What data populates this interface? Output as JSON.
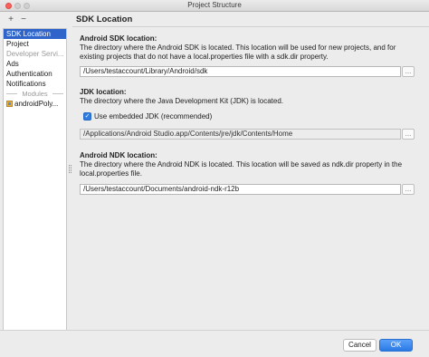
{
  "window": {
    "title": "Project Structure"
  },
  "sidebar": {
    "add_icon": "+",
    "remove_icon": "−",
    "items": [
      {
        "label": "SDK Location",
        "selected": true
      },
      {
        "label": "Project",
        "selected": false
      }
    ],
    "group_label": "Developer Servi...",
    "group_items": [
      "Ads",
      "Authentication",
      "Notifications"
    ],
    "modules_label": "Modules",
    "modules": [
      "androidPoly..."
    ]
  },
  "content": {
    "heading": "SDK Location",
    "android_sdk": {
      "title": "Android SDK location:",
      "description": "The directory where the Android SDK is located. This location will be used for new projects, and for existing projects that do not have a local.properties file with a sdk.dir property.",
      "value": "/Users/testaccount/Library/Android/sdk",
      "browse_label": "..."
    },
    "jdk": {
      "title": "JDK location:",
      "description": "The directory where the Java Development Kit (JDK) is located.",
      "checkbox_label": "Use embedded JDK (recommended)",
      "checkbox_checked": true,
      "value": "/Applications/Android Studio.app/Contents/jre/jdk/Contents/Home",
      "browse_label": "..."
    },
    "android_ndk": {
      "title": "Android NDK location:",
      "description": "The directory where the Android NDK is located. This location will be saved as ndk.dir property in the local.properties file.",
      "value": "/Users/testaccount/Documents/android-ndk-r12b",
      "browse_label": "..."
    }
  },
  "buttons": {
    "cancel": "Cancel",
    "ok": "OK"
  },
  "colors": {
    "selection": "#2f65ca",
    "primary_button": "#2a7ae6",
    "close_button": "#fc605c"
  }
}
